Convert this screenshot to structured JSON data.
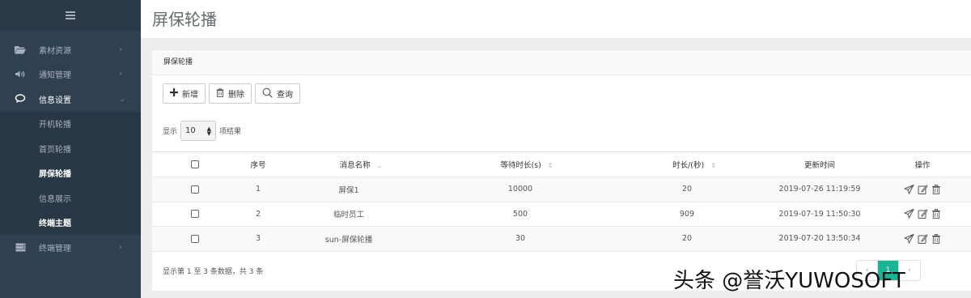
{
  "sidebar": {
    "items": [
      {
        "label": "素材资源",
        "icon": "folder-icon",
        "chevron": "›"
      },
      {
        "label": "通知管理",
        "icon": "speaker-icon",
        "chevron": "›"
      },
      {
        "label": "信息设置",
        "icon": "chat-icon",
        "chevron": "⌄"
      }
    ],
    "sub_items": [
      {
        "label": "开机轮播"
      },
      {
        "label": "首页轮播"
      },
      {
        "label": "屏保轮播"
      },
      {
        "label": "信息展示"
      },
      {
        "label": "终端主题"
      }
    ],
    "last_item": {
      "label": "终端管理",
      "icon": "server-icon",
      "chevron": "›"
    }
  },
  "header": {
    "title": "屏保轮播"
  },
  "panel": {
    "title": "屏保轮播",
    "toolbar": {
      "add": "新增",
      "delete": "删除",
      "query": "查询"
    },
    "length": {
      "prefix": "显示",
      "value": "10",
      "suffix": "项结果"
    },
    "table": {
      "headers": [
        "序号",
        "消息名称",
        "等待时长(s)",
        "时长/(秒)",
        "更新时间",
        "操作"
      ],
      "rows": [
        {
          "index": "1",
          "name": "屏保1",
          "wait": "10000",
          "duration": "20",
          "updated": "2019-07-26 11:19:59"
        },
        {
          "index": "2",
          "name": "临时员工",
          "wait": "500",
          "duration": "909",
          "updated": "2019-07-19 11:50:30"
        },
        {
          "index": "3",
          "name": "sun-屏保轮播",
          "wait": "30",
          "duration": "20",
          "updated": "2019-07-20 13:50:34"
        }
      ]
    },
    "info": "显示第 1 至 3 条数据，共 3 条",
    "pager": {
      "prev": "‹",
      "current": "1",
      "next": "›"
    }
  },
  "watermark": "头条 @誉沃YUWOSOFT",
  "colors": {
    "sidebar": "#2f4050",
    "accent": "#1ab394"
  }
}
